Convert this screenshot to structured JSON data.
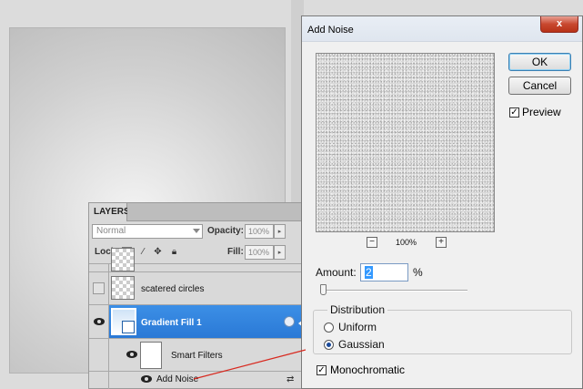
{
  "dialog": {
    "title": "Add Noise",
    "close_label": "x",
    "ok_label": "OK",
    "cancel_label": "Cancel",
    "preview_label": "Preview",
    "preview_checked": true,
    "zoom_out": "−",
    "zoom_in": "+",
    "zoom_level": "100%",
    "amount_label": "Amount:",
    "amount_value": "2",
    "amount_unit": "%",
    "amount_slider_fraction": 0.02,
    "distribution": {
      "label": "Distribution",
      "options": [
        "Uniform",
        "Gaussian"
      ],
      "selected": "Gaussian"
    },
    "monochromatic_label": "Monochromatic",
    "monochromatic_checked": true
  },
  "layers_panel": {
    "tab_label": "LAYERS",
    "blend_mode": "Normal",
    "opacity_label": "Opacity:",
    "opacity_value": "100%",
    "lock_label": "Lock:",
    "fill_label": "Fill:",
    "fill_value": "100%",
    "layers": [
      {
        "name": "scatered circles",
        "visible": false
      },
      {
        "name": "Gradient Fill 1",
        "visible": true,
        "selected": true
      },
      {
        "name": "Smart Filters",
        "visible": true
      },
      {
        "name": "Add Noise",
        "visible": true
      }
    ]
  },
  "colors": {
    "selection_blue": "#2a79d6",
    "annotation_red": "#d8291f",
    "close_red": "#c8482f"
  }
}
